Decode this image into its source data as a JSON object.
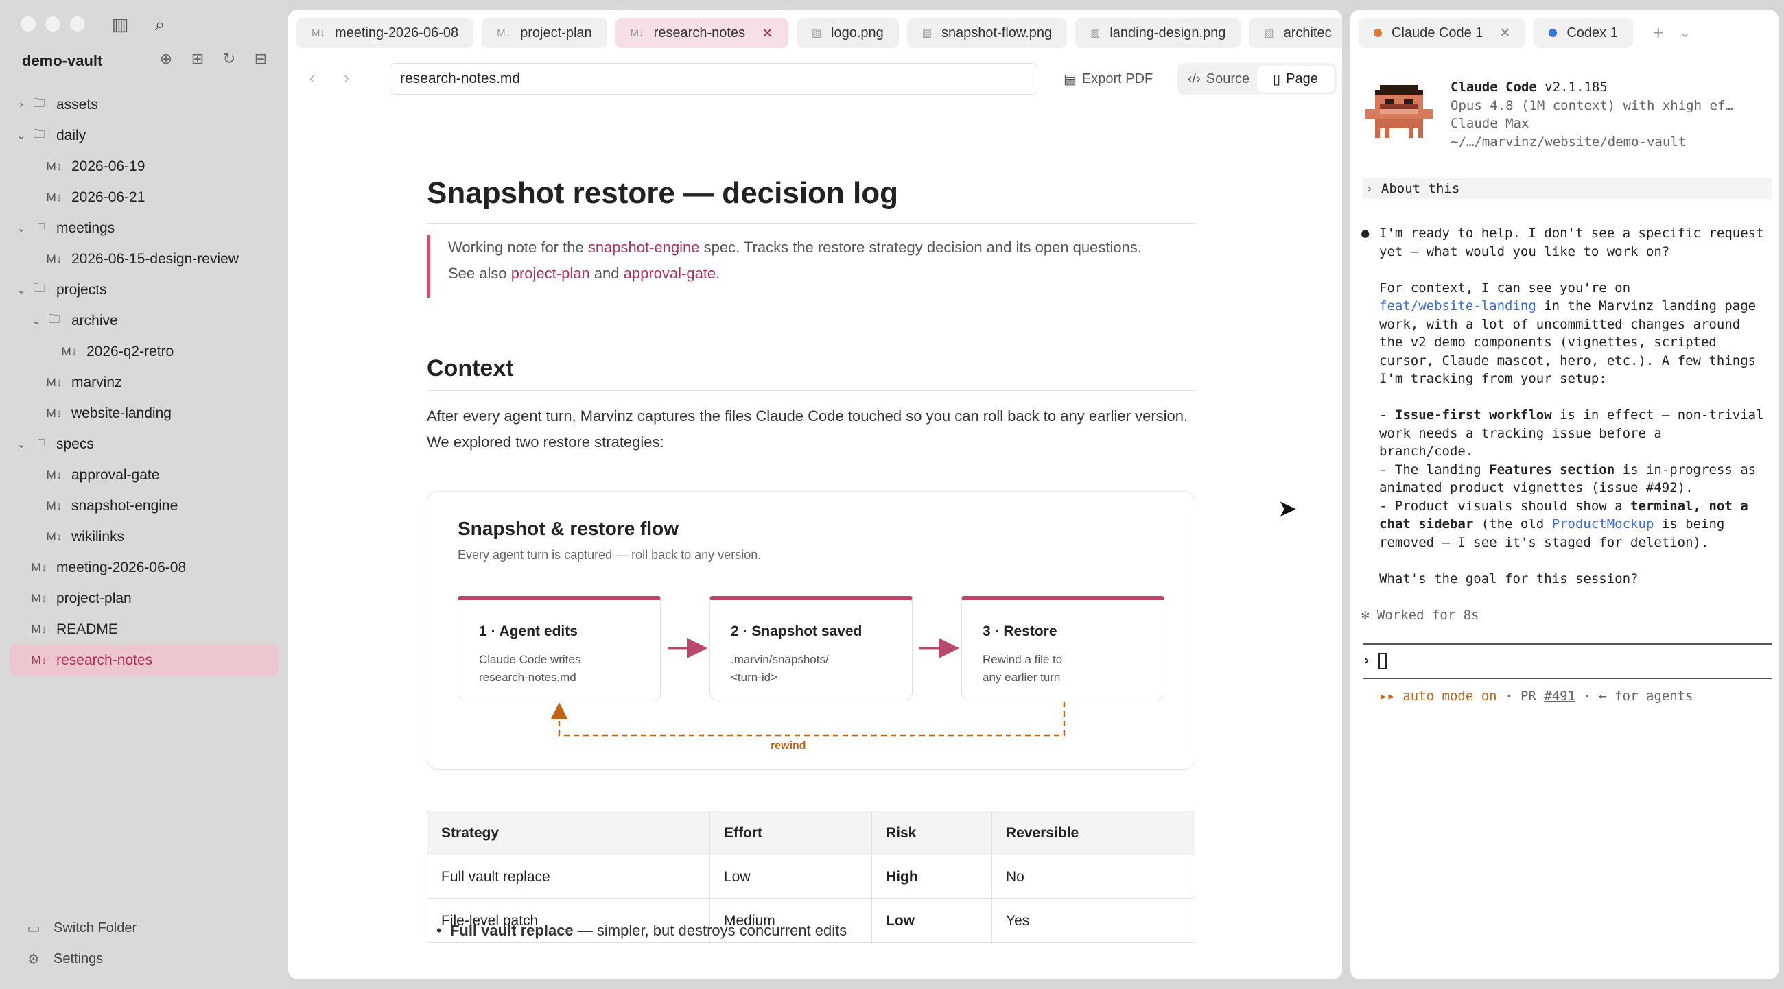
{
  "sidebar": {
    "vault_name": "demo-vault",
    "tree": [
      {
        "label": "assets",
        "kind": "folder",
        "depth": 0,
        "expanded": false
      },
      {
        "label": "daily",
        "kind": "folder",
        "depth": 0,
        "expanded": true
      },
      {
        "label": "2026-06-19",
        "kind": "file",
        "depth": 1
      },
      {
        "label": "2026-06-21",
        "kind": "file",
        "depth": 1
      },
      {
        "label": "meetings",
        "kind": "folder",
        "depth": 0,
        "expanded": true
      },
      {
        "label": "2026-06-15-design-review",
        "kind": "file",
        "depth": 1
      },
      {
        "label": "projects",
        "kind": "folder",
        "depth": 0,
        "expanded": true
      },
      {
        "label": "archive",
        "kind": "folder",
        "depth": 1,
        "expanded": true
      },
      {
        "label": "2026-q2-retro",
        "kind": "file",
        "depth": 2
      },
      {
        "label": "marvinz",
        "kind": "file",
        "depth": 1
      },
      {
        "label": "website-landing",
        "kind": "file",
        "depth": 1
      },
      {
        "label": "specs",
        "kind": "folder",
        "depth": 0,
        "expanded": true
      },
      {
        "label": "approval-gate",
        "kind": "file",
        "depth": 1
      },
      {
        "label": "snapshot-engine",
        "kind": "file",
        "depth": 1
      },
      {
        "label": "wikilinks",
        "kind": "file",
        "depth": 1
      },
      {
        "label": "meeting-2026-06-08",
        "kind": "file",
        "depth": 0
      },
      {
        "label": "project-plan",
        "kind": "file",
        "depth": 0
      },
      {
        "label": "README",
        "kind": "file",
        "depth": 0
      },
      {
        "label": "research-notes",
        "kind": "file",
        "depth": 0,
        "active": true
      }
    ],
    "switch_folder": "Switch Folder",
    "settings": "Settings"
  },
  "editor": {
    "tabs": [
      {
        "label": "meeting-2026-06-08",
        "icon": "markdown-icon"
      },
      {
        "label": "project-plan",
        "icon": "markdown-icon"
      },
      {
        "label": "research-notes",
        "icon": "markdown-icon",
        "active": true
      },
      {
        "label": "logo.png",
        "icon": "image-icon"
      },
      {
        "label": "snapshot-flow.png",
        "icon": "image-icon"
      },
      {
        "label": "landing-design.png",
        "icon": "image-icon"
      },
      {
        "label": "architec",
        "icon": "image-icon"
      }
    ],
    "path": "research-notes.md",
    "export_label": "Export PDF",
    "source_label": "Source",
    "page_label": "Page"
  },
  "doc": {
    "title": "Snapshot restore — decision log",
    "callout": {
      "pre": "Working note for the ",
      "link1": "snapshot-engine",
      "mid": " spec. Tracks the restore strategy decision and its open questions.",
      "see": "See also ",
      "link2": "project-plan",
      "and": " and ",
      "link3": "approval-gate",
      "end": "."
    },
    "context_heading": "Context",
    "context_para": "After every agent turn, Marvinz captures the files Claude Code touched so you can roll back to any earlier version. We explored two restore strategies:",
    "flow": {
      "title": "Snapshot & restore flow",
      "subtitle": "Every agent turn is captured — roll back to any version.",
      "steps": [
        {
          "title": "1 · Agent edits",
          "line1": "Claude Code writes",
          "line2": "research-notes.md"
        },
        {
          "title": "2 · Snapshot saved",
          "line1": ".marvin/snapshots/",
          "line2": "<turn-id>"
        },
        {
          "title": "3 · Restore",
          "line1": "Rewind a file to",
          "line2": "any earlier turn"
        }
      ],
      "rewind_label": "rewind",
      "accent": "#b8496a",
      "rewind_color": "#c06418"
    },
    "table": {
      "headers": [
        "Strategy",
        "Effort",
        "Risk",
        "Reversible"
      ],
      "rows": [
        [
          "Full vault replace",
          "Low",
          "High",
          "No"
        ],
        [
          "File-level patch",
          "Medium",
          "Low",
          "Yes"
        ]
      ]
    },
    "bullet": {
      "bold": "Full vault replace",
      "rest": " — simpler, but destroys concurrent edits"
    }
  },
  "terminal": {
    "tabs": [
      {
        "label": "Claude Code 1",
        "dot": "#d97a3a",
        "closable": true
      },
      {
        "label": "Codex 1",
        "dot": "#3b73d9",
        "closable": false
      }
    ],
    "header": {
      "app": "Claude Code",
      "version": " v2.1.185",
      "model": "Opus 4.8 (1M context) with xhigh ef…",
      "plan": "Claude Max",
      "path": "~/…/marvinz/website/demo-vault"
    },
    "about": "About this",
    "msg": {
      "l1": "I'm ready to help. I don't see a specific request",
      "l2": "yet — what would you like to work on?",
      "c1": "For context, I can see you're on",
      "branch": "feat/website-landing",
      "c2": " in the Marvinz landing page",
      "c3": "work, with a lot of uncommitted changes around",
      "c4": "the v2 demo components (vignettes, scripted",
      "c5": "cursor, Claude mascot, hero, etc.). A few things",
      "c6": "I'm tracking from your setup:",
      "b1a": "- ",
      "b1b": "Issue-first workflow",
      "b1c": " is in effect — non-trivial",
      "b1d": "work needs a tracking issue before a",
      "b1e": "branch/code.",
      "b2a": "- The landing ",
      "b2b": "Features section",
      "b2c": " is in-progress as",
      "b2d": "animated product vignettes (issue #492).",
      "b3a": "- Product visuals should show a ",
      "b3b": "terminal, not a",
      "b3c": "chat sidebar",
      "b3d": " (the old ",
      "b3e": "ProductMockup",
      "b3f": " is being",
      "b3g": "removed — I see it's staged for deletion).",
      "q": "What's the goal for this session?"
    },
    "worked": "Worked for 8s",
    "status": {
      "a": "auto mode on",
      "b": " · PR ",
      "pr": "#491",
      "c": " · ← for agents"
    }
  }
}
